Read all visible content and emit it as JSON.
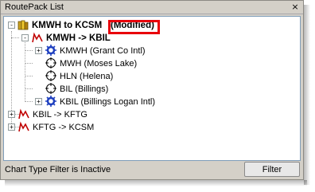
{
  "window": {
    "title": "RoutePack List",
    "close_glyph": "×"
  },
  "tree": {
    "root": {
      "label": "KMWH to KCSM",
      "badge": "(Modified)",
      "expander": "-"
    },
    "routes": [
      {
        "label": "KMWH -> KBIL",
        "expander": "-",
        "bold": true,
        "points": [
          {
            "label": "KMWH (Grant Co Intl)",
            "icon": "airport-gear-icon",
            "expander": "+"
          },
          {
            "label": "MWH (Moses Lake)",
            "icon": "vor-crosshair-icon"
          },
          {
            "label": "HLN (Helena)",
            "icon": "vor-crosshair-icon"
          },
          {
            "label": "BIL (Billings)",
            "icon": "vor-crosshair-icon"
          },
          {
            "label": "KBIL (Billings Logan Intl)",
            "icon": "airport-gear-icon",
            "expander": "+"
          }
        ]
      },
      {
        "label": "KBIL -> KFTG",
        "expander": "+"
      },
      {
        "label": "KFTG -> KCSM",
        "expander": "+"
      }
    ]
  },
  "status": {
    "text": "Chart Type Filter is Inactive"
  },
  "filter_button": {
    "label": "Filter"
  },
  "colors": {
    "highlight_border": "#e8000b",
    "route_icon": "#c00000",
    "airport_icon": "#1e3fbf"
  }
}
